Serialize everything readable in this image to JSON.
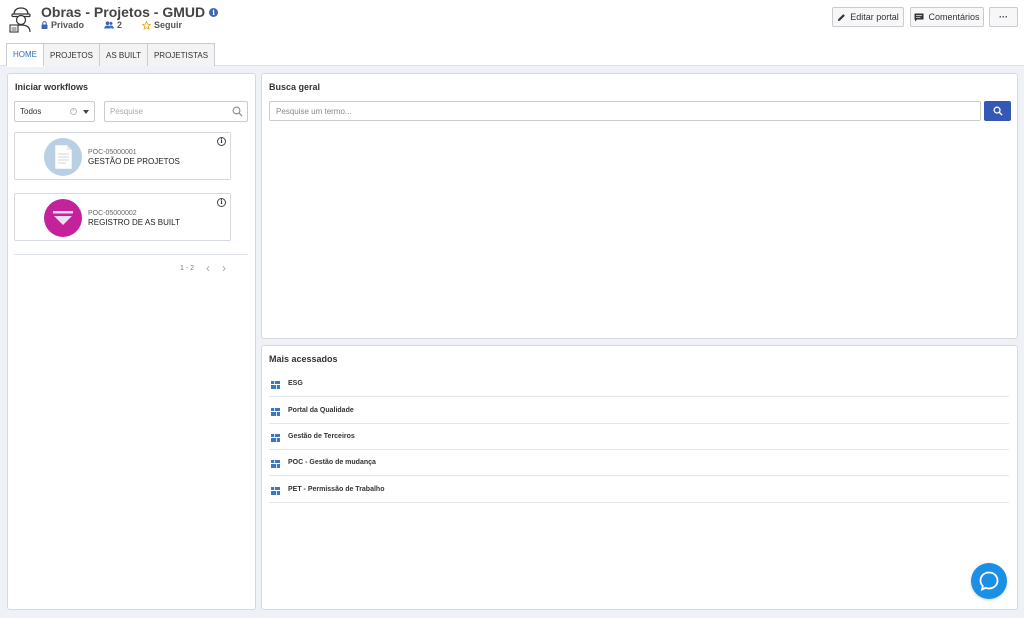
{
  "header": {
    "title": "Obras - Projetos - GMUD",
    "privacy": "Privado",
    "members": "2",
    "follow": "Seguir",
    "edit_label": "Editar portal",
    "comments_label": "Comentários",
    "more_label": "···",
    "accent_color": "#3a66b7"
  },
  "tabs": [
    {
      "label": "HOME",
      "active": true
    },
    {
      "label": "PROJETOS",
      "active": false
    },
    {
      "label": "AS BUILT",
      "active": false
    },
    {
      "label": "PROJETISTAS",
      "active": false
    }
  ],
  "workflows": {
    "title": "Iniciar workflows",
    "filter_value": "Todos",
    "search_placeholder": "Pesquise",
    "items": [
      {
        "code": "POC-05000001",
        "name": "GESTÃO DE PROJETOS",
        "icon": "document-icon",
        "color": "#b9cfe3"
      },
      {
        "code": "POC-05000002",
        "name": "REGISTRO DE AS BUILT",
        "icon": "download-arrow-icon",
        "color": "#c4229a"
      }
    ],
    "pagination": "1 - 2",
    "prev": "‹",
    "next": "›"
  },
  "busca": {
    "title": "Busca geral",
    "placeholder": "Pesquise um termo..."
  },
  "mais_acessados": {
    "title": "Mais acessados",
    "items": [
      {
        "label": "ESG"
      },
      {
        "label": "Portal da Qualidade"
      },
      {
        "label": "Gestão de Terceiros"
      },
      {
        "label": "POC - Gestão de mudança"
      },
      {
        "label": "PET - Permissão de Trabalho"
      }
    ]
  }
}
